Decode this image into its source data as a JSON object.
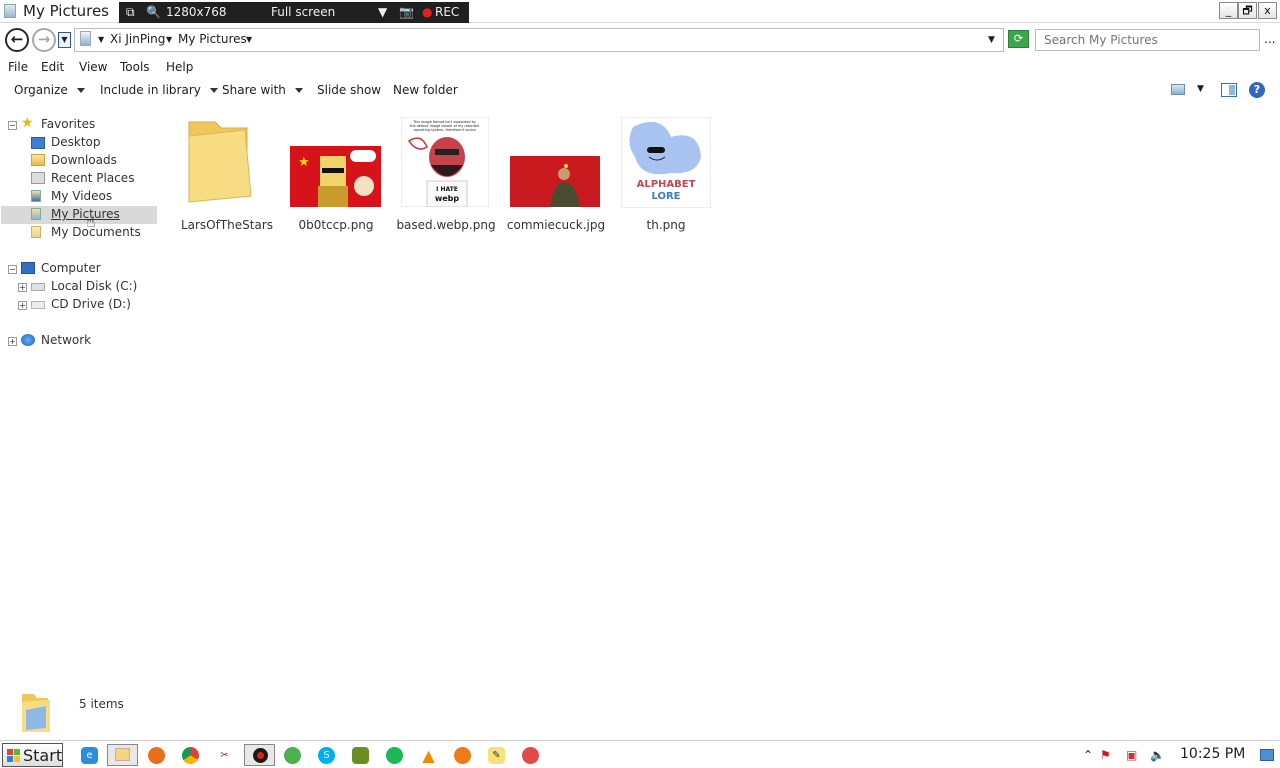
{
  "window": {
    "title": "My Pictures",
    "minimize": "_",
    "restore": "🗗",
    "close": "x"
  },
  "recorder": {
    "resolution": "1280x768",
    "mode": "Full screen",
    "rec_label": "REC"
  },
  "address": {
    "crumbs": [
      "Xi JinPing",
      "My Pictures"
    ],
    "search_placeholder": "Search My Pictures",
    "more": "..."
  },
  "menu": [
    "File",
    "Edit",
    "View",
    "Tools",
    "Help"
  ],
  "toolbar": {
    "organize": "Organize",
    "include": "Include in library",
    "share": "Share with",
    "slideshow": "Slide show",
    "new_folder": "New folder"
  },
  "nav": {
    "favorites": "Favorites",
    "favorites_items": [
      "Desktop",
      "Downloads",
      "Recent Places",
      "My Videos",
      "My Pictures",
      "My Documents"
    ],
    "computer": "Computer",
    "computer_items": [
      "Local Disk (C:)",
      "CD Drive (D:)"
    ],
    "network": "Network"
  },
  "items": [
    {
      "name": "LarsOfTheStars",
      "icon": "folder-icon"
    },
    {
      "name": "0b0tccp.png",
      "icon": "image-thumbnail"
    },
    {
      "name": "based.webp.png",
      "icon": "image-thumbnail"
    },
    {
      "name": "commiecuck.jpg",
      "icon": "image-thumbnail"
    },
    {
      "name": "th.png",
      "icon": "image-thumbnail"
    }
  ],
  "thumb_text": {
    "based_caption": "This image format isn't supported by the default image viewer of my retarded operating system, therefore it sucks!",
    "based_shirt_1": "I HATE",
    "based_shirt_2": "webp",
    "th_line_1": "ALPHABET",
    "th_line_2": "LORE"
  },
  "status": {
    "count": "5 items"
  },
  "taskbar": {
    "start": "Start",
    "clock": "10:25 PM"
  },
  "colors": {
    "folder": "#f6d77a",
    "selection": "#d9d9d9",
    "red_flag": "#d6121b"
  }
}
